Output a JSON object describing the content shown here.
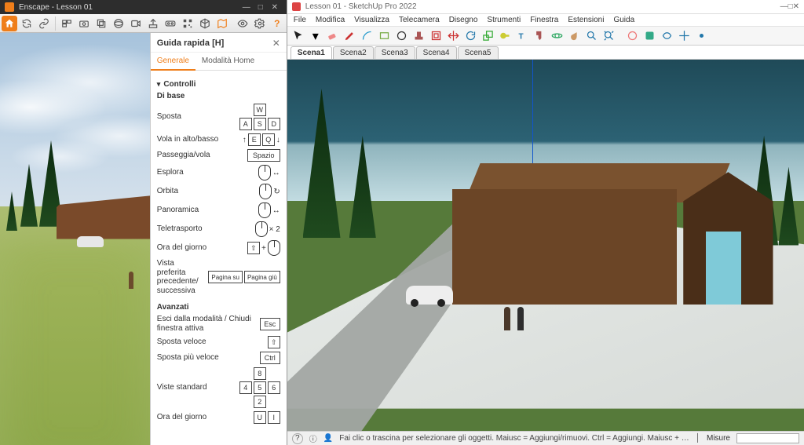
{
  "left": {
    "title": "Enscape - Lesson 01",
    "winbtns": {
      "min": "—",
      "max": "□",
      "close": "✕"
    },
    "help": {
      "title": "Guida rapida [H]",
      "tabs": {
        "general": "Generale",
        "home": "Modalità Home"
      },
      "section_controls": "Controlli",
      "basic_h": "Di base",
      "rows": {
        "move": "Sposta",
        "fly": "Vola in alto/basso",
        "walk": "Passeggia/vola",
        "look": "Esplora",
        "orbit": "Orbita",
        "pan": "Panoramica",
        "teleport": "Teletrasporto",
        "tod": "Ora del giorno",
        "favview": "Vista preferita precedente/ successiva"
      },
      "keys": {
        "w": "W",
        "a": "A",
        "s": "S",
        "d": "D",
        "e": "E",
        "q": "Q",
        "space": "Spazio",
        "plus2": "× 2",
        "pgup": "Pagina su",
        "pgdn": "Pagina giù",
        "esc": "Esc",
        "ctrl": "Ctrl",
        "u": "U",
        "i": "I"
      },
      "advanced_h": "Avanzati",
      "adv": {
        "escmode": "Esci dalla modalità / Chiudi finestra attiva",
        "fast": "Sposta veloce",
        "faster": "Sposta più veloce",
        "stdview": "Viste standard",
        "tod2": "Ora del giorno"
      },
      "numkeys": {
        "k8": "8",
        "k4": "4",
        "k5": "5",
        "k6": "6",
        "k2": "2"
      }
    }
  },
  "right": {
    "title": "Lesson 01 - SketchUp Pro 2022",
    "winbtns": {
      "min": "—",
      "max": "□",
      "close": "✕"
    },
    "menu": [
      "File",
      "Modifica",
      "Visualizza",
      "Telecamera",
      "Disegno",
      "Strumenti",
      "Finestra",
      "Estensioni",
      "Guida"
    ],
    "scenes": [
      "Scena1",
      "Scena2",
      "Scena3",
      "Scena4",
      "Scena5"
    ],
    "status": {
      "help_icon": "?",
      "hint": "Fai clic o trascina per selezionare gli oggetti. Maiusc = Aggiungi/rimuovi. Ctrl = Aggiungi. Maiusc + …",
      "measure_label": "Misure"
    }
  }
}
